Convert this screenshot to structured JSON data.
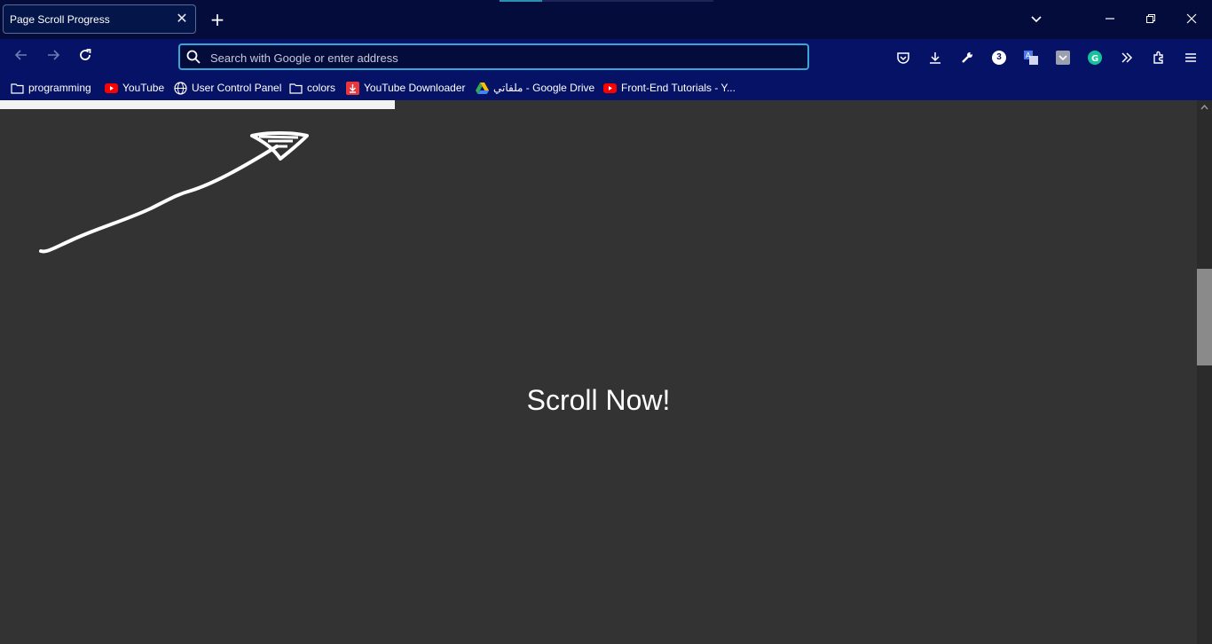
{
  "tab": {
    "title": "Page Scroll Progress",
    "close_glyph": "✕"
  },
  "new_tab_glyph": "+",
  "window_controls": {
    "list_tabs": "⌄",
    "minimize": "—",
    "restore": "❐",
    "close": "✕"
  },
  "nav": {
    "back": "←",
    "forward": "→",
    "reload": "↻"
  },
  "urlbar": {
    "placeholder": "Search with Google or enter address",
    "value": ""
  },
  "toolbar": {
    "badge_count": "3"
  },
  "bookmarks": [
    {
      "label": "programming",
      "icon": "folder-icon"
    },
    {
      "label": "YouTube",
      "icon": "youtube-icon"
    },
    {
      "label": "User Control Panel",
      "icon": "globe-icon"
    },
    {
      "label": "colors",
      "icon": "folder-icon"
    },
    {
      "label": "YouTube Downloader",
      "icon": "download-icon"
    },
    {
      "label": "ملفاتي - Google Drive",
      "icon": "google-drive-icon"
    },
    {
      "label": "Front-End Tutorials - Y...",
      "icon": "youtube-icon"
    }
  ],
  "page": {
    "heading": "Scroll Now!",
    "scroll_progress_percent": 33,
    "scrollbar_thumb_position_percent": 31,
    "progress_color": "#f2f2f2",
    "background_color": "#333333"
  },
  "colors": {
    "titlebar": "#030c3a",
    "navbar": "#051265",
    "url_focus": "#3aa6d3"
  }
}
